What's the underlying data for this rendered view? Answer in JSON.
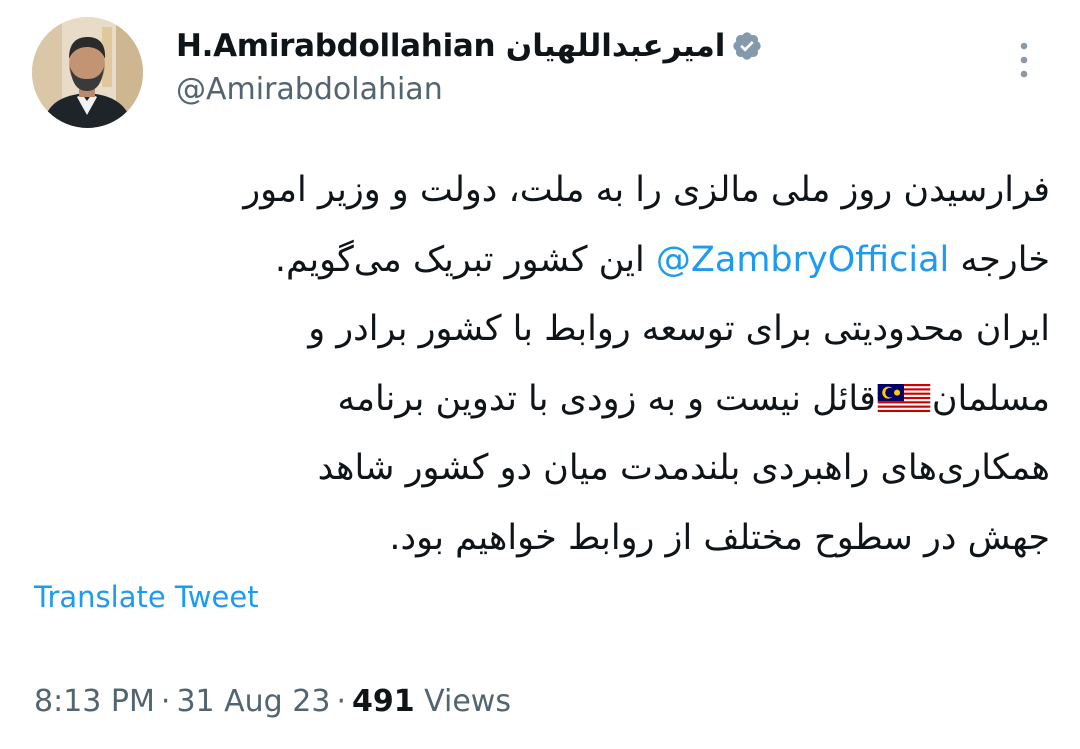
{
  "author": {
    "display_name": "H.Amirabdollahian امیرعبداللهیان",
    "handle": "@Amirabdolahian",
    "verified": true
  },
  "tweet": {
    "line1": "فرارسیدن روز ملی مالزی را به ملت، دولت و وزیر امور",
    "line2_before": "خارجه ",
    "mention": "@ZambryOfficial",
    "line2_after": " این کشور تبریک می‌گویم.",
    "line3": "ایران محدودیتی برای توسعه روابط با کشور برادر و",
    "line4_before": "مسلمان",
    "flag": "malaysia-flag",
    "line4_after": "قائل نیست و به زودی با تدوین برنامه",
    "line5": "همکاری‌های راهبردی بلندمدت میان دو کشور شاهد",
    "line6": "جهش در سطوح مختلف از روابط خواهیم بود."
  },
  "translate_label": "Translate Tweet",
  "meta": {
    "time": "8:13 PM",
    "separator": "·",
    "date": "31 Aug 23",
    "views_count": "491",
    "views_label": "Views"
  },
  "colors": {
    "accent": "#1d9bf0",
    "text": "#0f1419",
    "secondary": "#536471",
    "verified_badge": "#829aab"
  },
  "icons": {
    "verified": "verified-badge-icon",
    "more": "more-vertical-icon"
  }
}
